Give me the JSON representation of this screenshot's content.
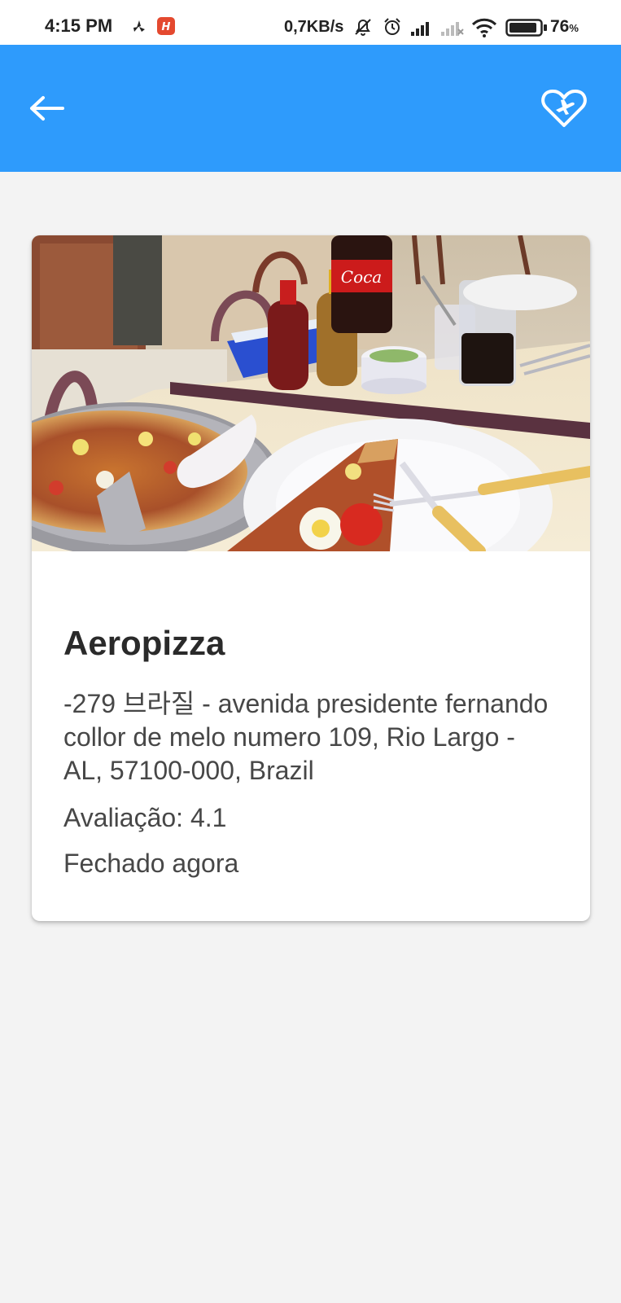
{
  "status_bar": {
    "time": "4:15 PM",
    "network_speed": "0,7KB/s",
    "battery_percent": "76",
    "battery_unit": "%",
    "icons": [
      "fan-icon",
      "app-notification-icon",
      "mute-icon",
      "alarm-icon",
      "signal-icon",
      "no-signal-icon",
      "wifi-icon",
      "battery-icon"
    ]
  },
  "app_bar": {
    "color": "#2e9bfc",
    "icons": [
      "back-arrow-icon",
      "heart-plane-icon"
    ]
  },
  "place": {
    "name": "Aeropizza",
    "address": "-279 브라질 - avenida presidente fernando collor de melo numero 109, Rio Largo - AL, 57100-000, Brazil",
    "rating": "Avaliação: 4.1",
    "open_status": "Fechado agora",
    "photo": "pizza-restaurant-photo"
  }
}
